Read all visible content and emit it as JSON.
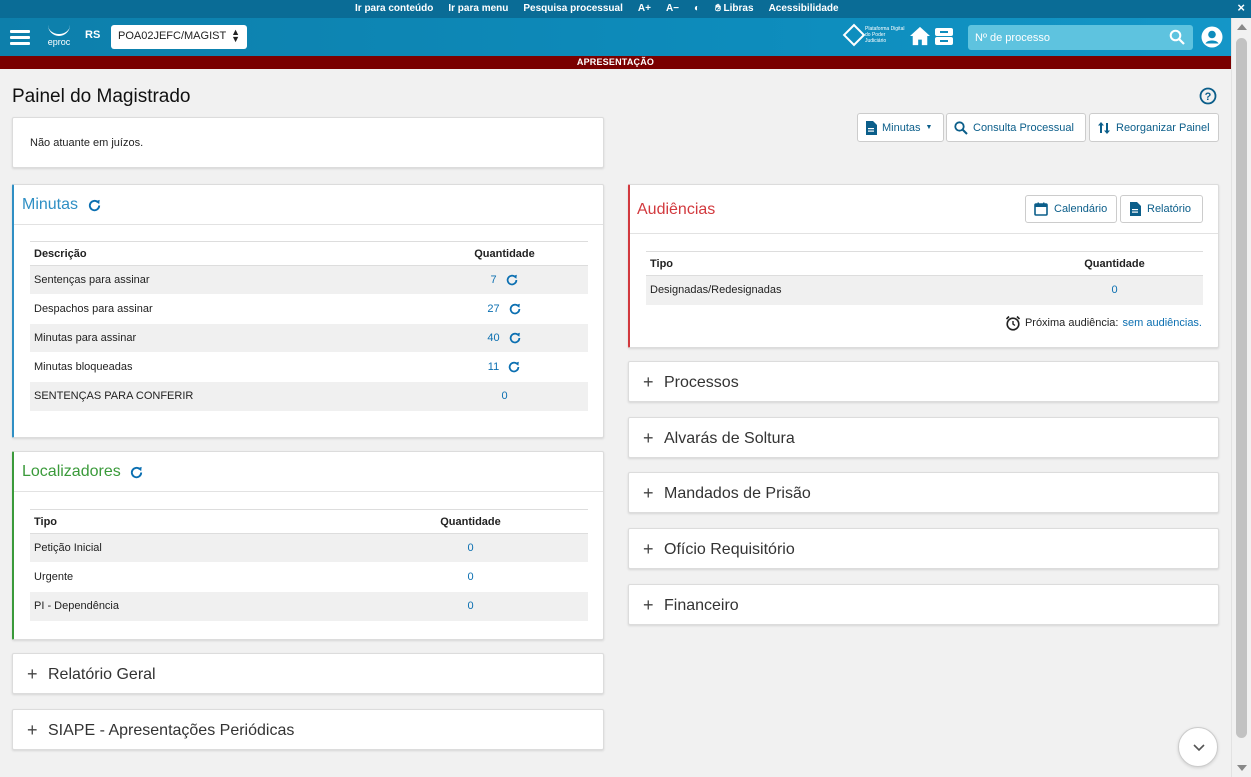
{
  "accessbar": {
    "links": [
      "Ir para conteúdo",
      "Ir para menu",
      "Pesquisa processual",
      "A+",
      "A−",
      "◐",
      "Libras",
      "Acessibilidade"
    ],
    "close": "×"
  },
  "header": {
    "logo": "eproc",
    "state": "RS",
    "org_select": "POA02JEFC/MAGIST",
    "platform": "Plataforma Digital do Poder Judiciário",
    "search_placeholder": "Nº de processo"
  },
  "banner": "APRESENTAÇÃO",
  "page": {
    "title": "Painel do Magistrado"
  },
  "notice": "Não atuante em juízos.",
  "toolbar": {
    "minutas": "Minutas",
    "consulta": "Consulta Processual",
    "reorganizar": "Reorganizar Painel"
  },
  "minutas": {
    "title": "Minutas",
    "col_desc": "Descrição",
    "col_qty": "Quantidade",
    "rows": [
      {
        "label": "Sentenças para assinar",
        "qty": "7"
      },
      {
        "label": "Despachos para assinar",
        "qty": "27"
      },
      {
        "label": "Minutas para assinar",
        "qty": "40"
      },
      {
        "label": "Minutas bloqueadas",
        "qty": "11"
      },
      {
        "label": "SENTENÇAS PARA CONFERIR",
        "qty": "0"
      }
    ]
  },
  "localizadores": {
    "title": "Localizadores",
    "col_tipo": "Tipo",
    "col_qty": "Quantidade",
    "rows": [
      {
        "label": "Petição Inicial",
        "qty": "0"
      },
      {
        "label": "Urgente",
        "qty": "0"
      },
      {
        "label": "PI - Dependência",
        "qty": "0"
      }
    ]
  },
  "audiencias": {
    "title": "Audiências",
    "calendario": "Calendário",
    "relatorio": "Relatório",
    "col_tipo": "Tipo",
    "col_qty": "Quantidade",
    "rows": [
      {
        "label": "Designadas/Redesignadas",
        "qty": "0"
      }
    ],
    "proxima_label": "Próxima audiência:",
    "proxima_value": "sem audiências."
  },
  "left_accordions": [
    "Relatório Geral",
    "SIAPE - Apresentações Periódicas"
  ],
  "right_accordions": [
    "Processos",
    "Alvarás de Soltura",
    "Mandados de Prisão",
    "Ofício Requisitório",
    "Financeiro"
  ],
  "colors": {
    "minutas_title": "#2f8fc4",
    "localizadores_title": "#3a9a3a",
    "audiencias_title": "#d2393e",
    "link": "#0b6fb1"
  }
}
